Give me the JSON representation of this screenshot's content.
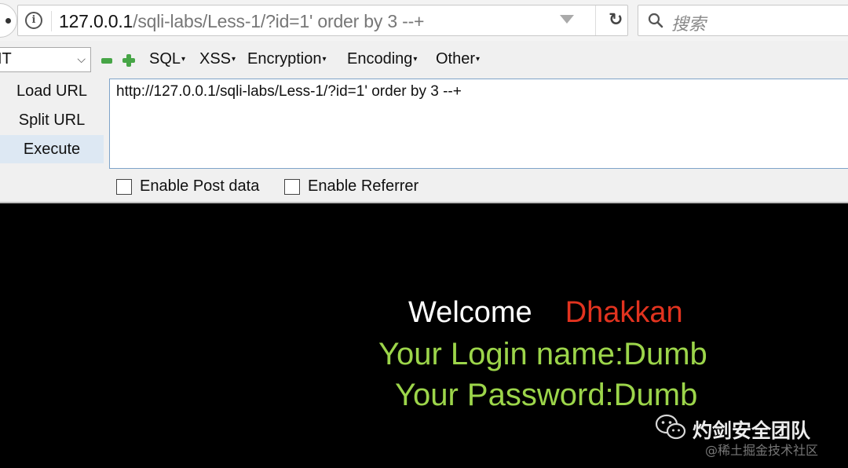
{
  "browser": {
    "url_host": "127.0.0.1",
    "url_path": "/sqli-labs/Less-1/?id=1' order by 3 --+",
    "search_placeholder": "搜索"
  },
  "hackbar": {
    "select_value": "IT",
    "menus": [
      {
        "label": "SQL"
      },
      {
        "label": "XSS"
      },
      {
        "label": "Encryption"
      },
      {
        "label": "Encoding"
      },
      {
        "label": "Other"
      }
    ],
    "buttons": {
      "load_url": "Load URL",
      "split_url": "Split URL",
      "execute": "Execute"
    },
    "textarea_value": "http://127.0.0.1/sqli-labs/Less-1/?id=1' order by 3 --+",
    "checkboxes": {
      "post_data": "Enable Post data",
      "referrer": "Enable Referrer"
    }
  },
  "page": {
    "welcome": "Welcome",
    "name": "Dhakkan",
    "login_line": "Your Login name:Dumb",
    "password_line": "Your Password:Dumb",
    "colors": {
      "welcome": "#ffffff",
      "name": "#e2331f",
      "result": "#9cd54a",
      "background": "#000000"
    }
  },
  "watermark": {
    "title": "灼剑安全团队",
    "subtitle": "@稀土掘金技术社区"
  }
}
